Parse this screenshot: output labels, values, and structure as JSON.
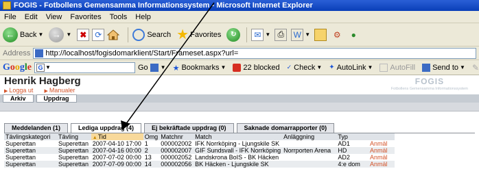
{
  "window": {
    "title": "FOGIS - Fotbollens Gemensamma Informationssystem - Microsoft Internet Explorer"
  },
  "menu": [
    "File",
    "Edit",
    "View",
    "Favorites",
    "Tools",
    "Help"
  ],
  "toolbar": {
    "back": "Back",
    "search": "Search",
    "favorites": "Favorites"
  },
  "address": {
    "label": "Address",
    "url": "http://localhost/fogisdomarklient/Start/Frameset.aspx?url="
  },
  "googlebar": {
    "logo": "Google",
    "go": "Go",
    "bookmarks": "Bookmarks",
    "blocked": "22 blocked",
    "check": "Check",
    "autolink": "AutoLink",
    "autofill": "AutoFill",
    "sendto": "Send to"
  },
  "user": {
    "name": "Henrik Hagberg",
    "logout": "Logga ut",
    "manuals": "Manualer"
  },
  "logo": {
    "title": "FOGIS",
    "subtitle": "Fotbollens Gemensamma Informationssystem"
  },
  "mainmenu": [
    "Arkiv",
    "Uppdrag"
  ],
  "tabs": [
    {
      "label": "Meddelanden (1)",
      "active": false
    },
    {
      "label": "Lediga uppdrag (4)",
      "active": true
    },
    {
      "label": "Ej bekräftade uppdrag (0)",
      "active": false
    },
    {
      "label": "Saknade domarrapporter (0)",
      "active": false
    }
  ],
  "table": {
    "columns": [
      "Tävlingskategori",
      "Tävling",
      "Tid",
      "Omg",
      "Matchnr",
      "Match",
      "Anläggning",
      "Typ",
      ""
    ],
    "sorted_column": "Tid",
    "rows": [
      [
        "Superettan",
        "Superettan",
        "2007-04-10 17:00",
        "1",
        "000002002",
        "IFK Norrköping - Ljungskile SK",
        "",
        "AD1",
        "Anmäl"
      ],
      [
        "Superettan",
        "Superettan",
        "2007-04-16 00:00",
        "2",
        "000002007",
        "GIF Sundsvall - IFK Norrköping",
        "Norrporten Arena",
        "HD",
        "Anmäl"
      ],
      [
        "Superettan",
        "Superettan",
        "2007-07-02 00:00",
        "13",
        "000002052",
        "Landskrona BoIS - BK Häcken",
        "",
        "AD2",
        "Anmäl"
      ],
      [
        "Superettan",
        "Superettan",
        "2007-07-09 00:00",
        "14",
        "000002056",
        "BK Häcken - Ljungskile SK",
        "",
        "4:e dom",
        "Anmäl"
      ]
    ]
  },
  "colors": {
    "link_orange": "#d4542a",
    "header_grey": "#dfe3e8",
    "sorted_header": "#f8d99b"
  }
}
